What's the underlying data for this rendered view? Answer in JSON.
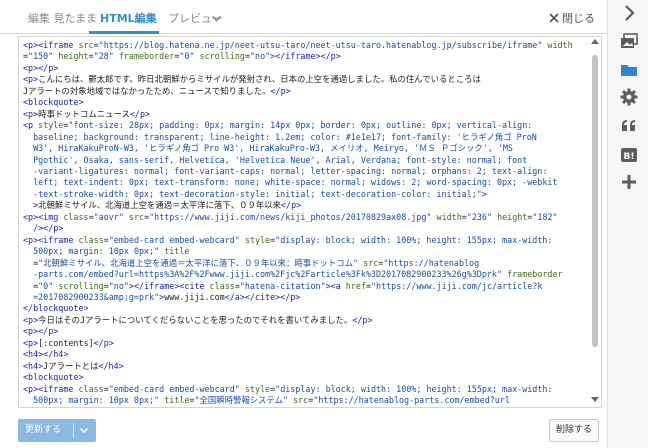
{
  "tabs": {
    "edit_label": "編集 見たまま",
    "html_label": "HTML編集",
    "preview_label": "プレビュー"
  },
  "close_label": "閉じる",
  "code_lines": [
    [
      [
        "t",
        "<p><iframe "
      ],
      [
        "a",
        "src"
      ],
      [
        "x",
        "="
      ],
      [
        "s",
        "\"https://blog.hatena.ne.jp/neet-utsu-taro/neet-utsu-taro.hatenablog.jp/subscribe/iframe\""
      ],
      [
        "x",
        " "
      ],
      [
        "a",
        "width"
      ]
    ],
    [
      [
        "x",
        "="
      ],
      [
        "s",
        "\"150\""
      ],
      [
        "x",
        " "
      ],
      [
        "a",
        "height"
      ],
      [
        "x",
        "="
      ],
      [
        "s",
        "\"28\""
      ],
      [
        "x",
        " "
      ],
      [
        "a",
        "frameborder"
      ],
      [
        "x",
        "="
      ],
      [
        "s",
        "\"0\""
      ],
      [
        "x",
        " "
      ],
      [
        "a",
        "scrolling"
      ],
      [
        "x",
        "="
      ],
      [
        "s",
        "\"no\""
      ],
      [
        "t",
        "></iframe></p>"
      ]
    ],
    [
      [
        "t",
        "<p></p>"
      ]
    ],
    [
      [
        "t",
        "<p>"
      ],
      [
        "x",
        "こんにちは、鬱太郎です。昨日北朝鮮からミサイルが発射され、日本の上空を通過しました。私の住んでいるところは"
      ]
    ],
    [
      [
        "x",
        "Jアラートの対象地域ではなかったため、ニュースで知りました。"
      ],
      [
        "t",
        "</p>"
      ]
    ],
    [
      [
        "t",
        "<blockquote>"
      ]
    ],
    [
      [
        "t",
        "<p>"
      ],
      [
        "x",
        "時事ドットコムニュース"
      ],
      [
        "t",
        "</p>"
      ]
    ],
    [
      [
        "t",
        "<p "
      ],
      [
        "a",
        "style"
      ],
      [
        "x",
        "="
      ],
      [
        "s",
        "\"font-size: 28px; padding: 0px; margin: 14px 0px; border: 0px; outline: 0px; vertical-align:"
      ]
    ],
    [
      [
        "s",
        "  baseline; background: transparent; line-height: 1.2em; color: #1e1e17; font-family: 'ヒラギノ角ゴ ProN"
      ]
    ],
    [
      [
        "s",
        "  W3', HiraKakuProN-W3, 'ヒラギノ角ゴ Pro W3', HiraKakuPro-W3, メイリオ, Meiryo, 'ＭＳ Ｐゴシック', 'MS"
      ]
    ],
    [
      [
        "s",
        "  Pgothic', Osaka, sans-serif, Helvetica, 'Helvetica Neue', Arial, Verdana; font-style: normal; font"
      ]
    ],
    [
      [
        "s",
        "  -variant-ligatures: normal; font-variant-caps: normal; letter-spacing: normal; orphans: 2; text-align:"
      ]
    ],
    [
      [
        "s",
        "  left; text-indent: 0px; text-transform: none; white-space: normal; widows: 2; word-spacing: 0px; -webkit"
      ]
    ],
    [
      [
        "s",
        "  -text-stroke-width: 0px; text-decoration-style: initial; text-decoration-color: initial;\""
      ],
      [
        "t",
        ">"
      ]
    ],
    [
      [
        "x",
        "  >北朝鮮ミサイル、北海道上空を通過＝太平洋に落下、０９年以来"
      ],
      [
        "t",
        "</p>"
      ]
    ],
    [
      [
        "t",
        "<p><img "
      ],
      [
        "a",
        "class"
      ],
      [
        "x",
        "="
      ],
      [
        "s",
        "\"aovr\""
      ],
      [
        "x",
        " "
      ],
      [
        "a",
        "src"
      ],
      [
        "x",
        "="
      ],
      [
        "s",
        "\"https://www.jiji.com/news/kiji_photos/20170829ax08.jpg\""
      ],
      [
        "x",
        " "
      ],
      [
        "a",
        "width"
      ],
      [
        "x",
        "="
      ],
      [
        "s",
        "\"236\""
      ],
      [
        "x",
        " "
      ],
      [
        "a",
        "height"
      ],
      [
        "x",
        "="
      ],
      [
        "s",
        "\"182\""
      ]
    ],
    [
      [
        "t",
        "  /></p>"
      ]
    ],
    [
      [
        "t",
        "<p><iframe "
      ],
      [
        "a",
        "class"
      ],
      [
        "x",
        "="
      ],
      [
        "s",
        "\"embed-card embed-webcard\""
      ],
      [
        "x",
        " "
      ],
      [
        "a",
        "style"
      ],
      [
        "x",
        "="
      ],
      [
        "s",
        "\"display: block; width: 100%; height: 155px; max-width:"
      ]
    ],
    [
      [
        "s",
        "  500px; margin: 10px 0px;\""
      ],
      [
        "x",
        " "
      ],
      [
        "a",
        "title"
      ]
    ],
    [
      [
        "x",
        "  ="
      ],
      [
        "s",
        "\"北朝鮮ミサイル、北海道上空を通過＝太平洋に落下、０９年以来：時事ドットコム\""
      ],
      [
        "x",
        " "
      ],
      [
        "a",
        "src"
      ],
      [
        "x",
        "="
      ],
      [
        "s",
        "\"https://hatenablog"
      ]
    ],
    [
      [
        "s",
        "  -parts.com/embed?url=https%3A%2F%2Fwww.jiji.com%2Fjc%2Farticle%3Fk%3D2017082900233%26g%3Dprk\""
      ],
      [
        "x",
        " "
      ],
      [
        "a",
        "frameborder"
      ]
    ],
    [
      [
        "x",
        "  ="
      ],
      [
        "s",
        "\"0\""
      ],
      [
        "x",
        " "
      ],
      [
        "a",
        "scrolling"
      ],
      [
        "x",
        "="
      ],
      [
        "s",
        "\"no\""
      ],
      [
        "t",
        "></iframe><cite "
      ],
      [
        "a",
        "class"
      ],
      [
        "x",
        "="
      ],
      [
        "s",
        "\"hatena-citation\""
      ],
      [
        "t",
        "><a "
      ],
      [
        "a",
        "href"
      ],
      [
        "x",
        "="
      ],
      [
        "s",
        "\"https://www.jiji.com/jc/article?k"
      ]
    ],
    [
      [
        "s",
        "  =2017082900233&amp;g=prk\""
      ],
      [
        "t",
        ">"
      ],
      [
        "x",
        "www.jiji.com"
      ],
      [
        "t",
        "</a></cite></p>"
      ]
    ],
    [
      [
        "t",
        "</blockquote>"
      ]
    ],
    [
      [
        "t",
        "<p>"
      ],
      [
        "x",
        "今日はそのJアラートについてくだらないことを思ったのでそれを書いてみました。"
      ],
      [
        "t",
        "</p>"
      ]
    ],
    [
      [
        "t",
        "<p></p>"
      ]
    ],
    [
      [
        "t",
        "<p>"
      ],
      [
        "x",
        "[:contents]"
      ],
      [
        "t",
        "</p>"
      ]
    ],
    [
      [
        "t",
        "<h4></h4>"
      ]
    ],
    [
      [
        "t",
        "<h4>"
      ],
      [
        "x",
        "Jアラートとは"
      ],
      [
        "t",
        "</h4>"
      ]
    ],
    [
      [
        "t",
        "<blockquote>"
      ]
    ],
    [
      [
        "t",
        "<p><iframe "
      ],
      [
        "a",
        "class"
      ],
      [
        "x",
        "="
      ],
      [
        "s",
        "\"embed-card embed-webcard\""
      ],
      [
        "x",
        " "
      ],
      [
        "a",
        "style"
      ],
      [
        "x",
        "="
      ],
      [
        "s",
        "\"display: block; width: 100%; height: 155px; max-width:"
      ]
    ],
    [
      [
        "s",
        "  500px; margin: 10px 0px;\""
      ],
      [
        "x",
        " "
      ],
      [
        "a",
        "title"
      ],
      [
        "x",
        "="
      ],
      [
        "s",
        "\"全国瞬時警報システム\""
      ],
      [
        "x",
        " "
      ],
      [
        "a",
        "src"
      ],
      [
        "x",
        "="
      ],
      [
        "s",
        "\"https://hatenablog-parts.com/embed?url"
      ]
    ],
    [
      [
        "s",
        "  =http%3A%2F%2Fd.hatena.ne"
      ]
    ]
  ],
  "update_label": "更新する",
  "delete_label": "削除する",
  "sidebar_icons": [
    "chevron-right-icon",
    "images-icon",
    "folder-icon",
    "gear-icon",
    "quote-icon",
    "bookmark-icon",
    "plus-icon"
  ]
}
